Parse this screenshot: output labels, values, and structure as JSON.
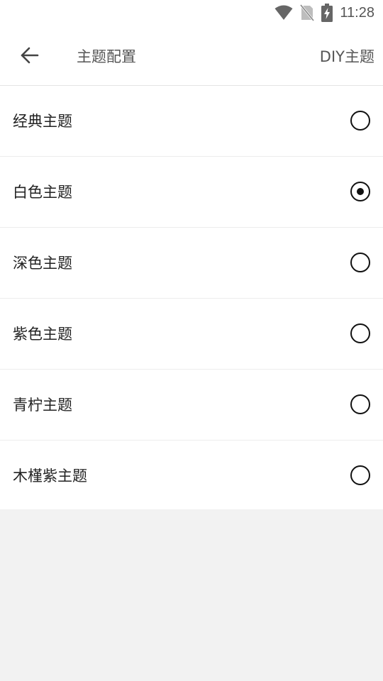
{
  "status_bar": {
    "time": "11:28",
    "icons": [
      "wifi-icon",
      "no-sim-icon",
      "battery-charging-icon"
    ]
  },
  "toolbar": {
    "back_icon": "arrow-left-icon",
    "title": "主题配置",
    "diy_label": "DIY主题"
  },
  "themes": [
    {
      "label": "经典主题",
      "selected": false
    },
    {
      "label": "白色主题",
      "selected": true
    },
    {
      "label": "深色主题",
      "selected": false
    },
    {
      "label": "紫色主题",
      "selected": false
    },
    {
      "label": "青柠主题",
      "selected": false
    },
    {
      "label": "木槿紫主题",
      "selected": false
    }
  ],
  "colors": {
    "background": "#f2f2f2",
    "surface": "#ffffff",
    "text": "#222222",
    "secondary_text": "#555555",
    "radio": "#111111"
  }
}
